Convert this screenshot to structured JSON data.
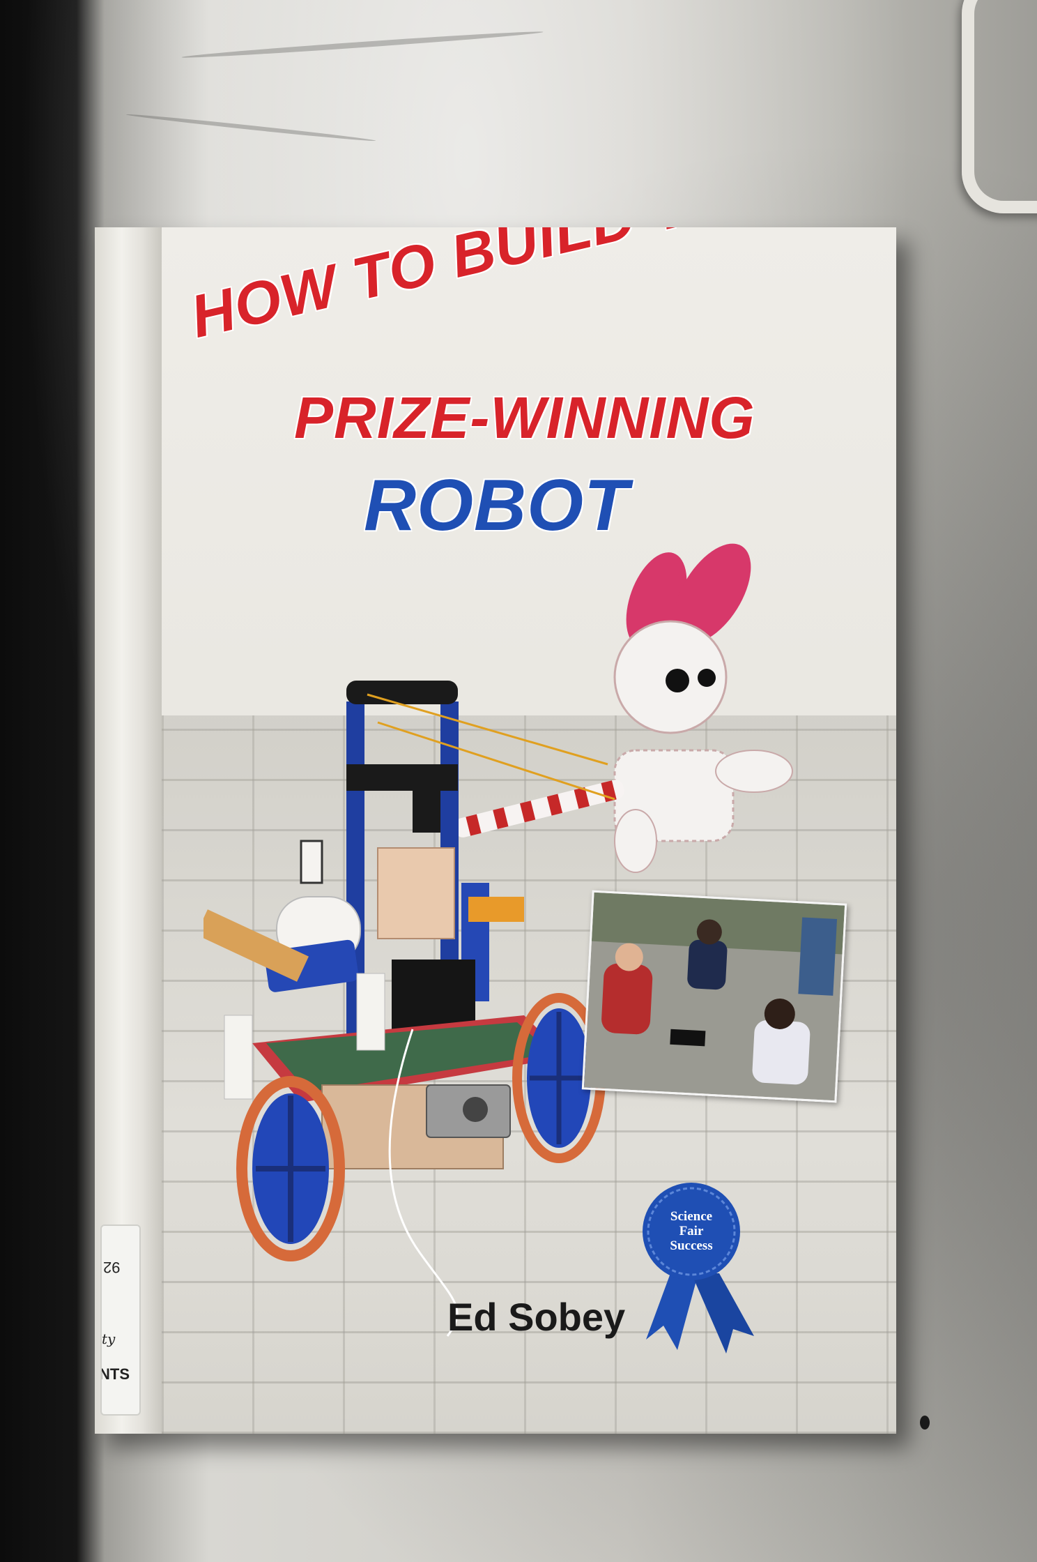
{
  "book": {
    "title_line_1": "HOW TO BUILD YOUR OWN",
    "title_line_2": "PRIZE-WINNING",
    "title_line_3": "ROBOT",
    "author": "Ed Sobey",
    "ribbon": {
      "line_1": "Science",
      "line_2": "Fair",
      "line_3": "Success"
    },
    "spine_label": {
      "code_fragment": "92",
      "bottom_fragment": "NTS"
    }
  },
  "colors": {
    "title_red": "#d8232a",
    "title_blue": "#1f4fb4",
    "ribbon_blue": "#1f4fb4",
    "author_black": "#1a1a1a"
  }
}
